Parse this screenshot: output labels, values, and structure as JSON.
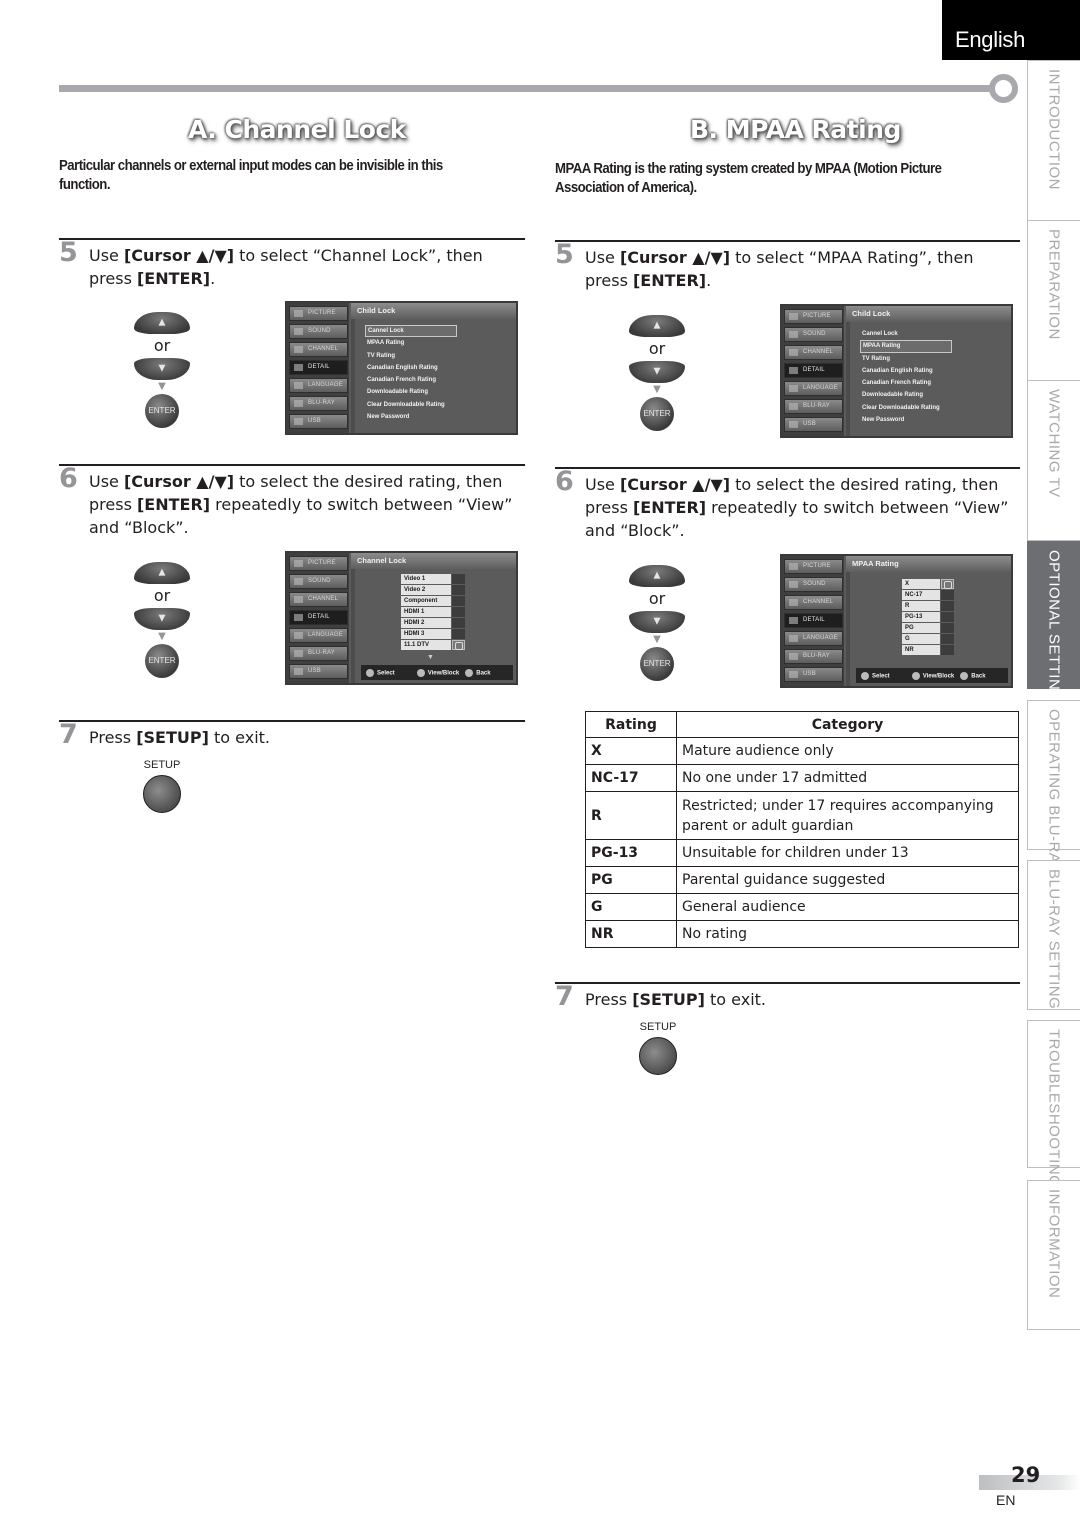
{
  "header": {
    "language": "English"
  },
  "side_tabs": [
    {
      "label": "INTRODUCTION",
      "active": false
    },
    {
      "label": "PREPARATION",
      "active": false
    },
    {
      "label": "WATCHING TV",
      "active": false
    },
    {
      "label": "OPTIONAL SETTING",
      "active": true
    },
    {
      "label": "OPERATING BLU-RAY",
      "active": false
    },
    {
      "label": "BLU-RAY SETTING",
      "active": false
    },
    {
      "label": "TROUBLESHOOTING",
      "active": false
    },
    {
      "label": "INFORMATION",
      "active": false
    }
  ],
  "section_a": {
    "title": "A.  Channel Lock",
    "description": "Particular channels or external input modes can be invisible in this function.",
    "step5": {
      "num": "5",
      "pre": "Use ",
      "b1": "[Cursor ▲/▼]",
      "mid": " to select “Channel Lock”, then press ",
      "b2": "[ENTER]",
      "post": "."
    },
    "step6": {
      "num": "6",
      "pre": "Use ",
      "b1": "[Cursor ▲/▼]",
      "mid": " to select the desired rating, then press ",
      "b2": "[ENTER]",
      "post": " repeatedly to switch between “View” and “Block”."
    },
    "step7": {
      "num": "7",
      "pre": "Press ",
      "b1": "[SETUP]",
      "post": " to exit."
    },
    "screen1": {
      "header": "Child Lock",
      "items": [
        "Cannel Lock",
        "MPAA Rating",
        "TV Rating",
        "Canadian English Rating",
        "Canadian French Rating",
        "Downloadable Rating",
        "Clear Downloadable Rating",
        "New Password"
      ],
      "selected": "Cannel Lock"
    },
    "screen2": {
      "header": "Channel Lock",
      "options": [
        {
          "label": "Video 1",
          "locked": false
        },
        {
          "label": "Video 2",
          "locked": false
        },
        {
          "label": "Component",
          "locked": false
        },
        {
          "label": "HDMI 1",
          "locked": false
        },
        {
          "label": "HDMI 2",
          "locked": false
        },
        {
          "label": "HDMI 3",
          "locked": false
        },
        {
          "label": "11.1 DTV",
          "locked": true
        }
      ]
    }
  },
  "section_b": {
    "title": "B. MPAA Rating",
    "description": "MPAA Rating is the rating system created by MPAA (Motion Picture Association of America).",
    "step5": {
      "num": "5",
      "pre": "Use ",
      "b1": "[Cursor ▲/▼]",
      "mid": " to select “MPAA Rating”, then press ",
      "b2": "[ENTER]",
      "post": "."
    },
    "step6": {
      "num": "6",
      "pre": "Use ",
      "b1": "[Cursor ▲/▼]",
      "mid": " to select the desired rating, then press ",
      "b2": "[ENTER]",
      "post": " repeatedly to switch between “View” and “Block”."
    },
    "step7": {
      "num": "7",
      "pre": "Press ",
      "b1": "[SETUP]",
      "post": " to exit."
    },
    "screen1": {
      "header": "Child Lock",
      "items": [
        "Cannel Lock",
        "MPAA Rating",
        "TV Rating",
        "Canadian English Rating",
        "Canadian French Rating",
        "Downloadable Rating",
        "Clear Downloadable Rating",
        "New Password"
      ],
      "selected": "MPAA Rating"
    },
    "screen2": {
      "header": "MPAA Rating",
      "options": [
        {
          "label": "X",
          "locked": true
        },
        {
          "label": "NC-17",
          "locked": false
        },
        {
          "label": "R",
          "locked": false
        },
        {
          "label": "PG-13",
          "locked": false
        },
        {
          "label": "PG",
          "locked": false
        },
        {
          "label": "G",
          "locked": false
        },
        {
          "label": "NR",
          "locked": false
        }
      ]
    },
    "table": {
      "headers": [
        "Rating",
        "Category"
      ],
      "rows": [
        {
          "rating": "X",
          "category": "Mature audience only"
        },
        {
          "rating": "NC-17",
          "category": "No one under 17 admitted"
        },
        {
          "rating": "R",
          "category": "Restricted; under 17 requires accompanying parent or adult guardian"
        },
        {
          "rating": "PG-13",
          "category": "Unsuitable for children under 13"
        },
        {
          "rating": "PG",
          "category": "Parental guidance suggested"
        },
        {
          "rating": "G",
          "category": "General audience"
        },
        {
          "rating": "NR",
          "category": "No rating"
        }
      ]
    }
  },
  "remote": {
    "up_icon": "▲",
    "down_icon": "▼",
    "or": "or",
    "enter": "ENTER",
    "setup": "SETUP"
  },
  "tv_menu": {
    "side_items": [
      "PICTURE",
      "SOUND",
      "CHANNEL",
      "DETAIL",
      "LANGUAGE",
      "BLU-RAY",
      "USB"
    ],
    "active_item": "DETAIL",
    "footer": {
      "select": "Select",
      "view_block": "View/Block",
      "back": "Back"
    }
  },
  "footer": {
    "page": "29",
    "lang": "EN"
  }
}
